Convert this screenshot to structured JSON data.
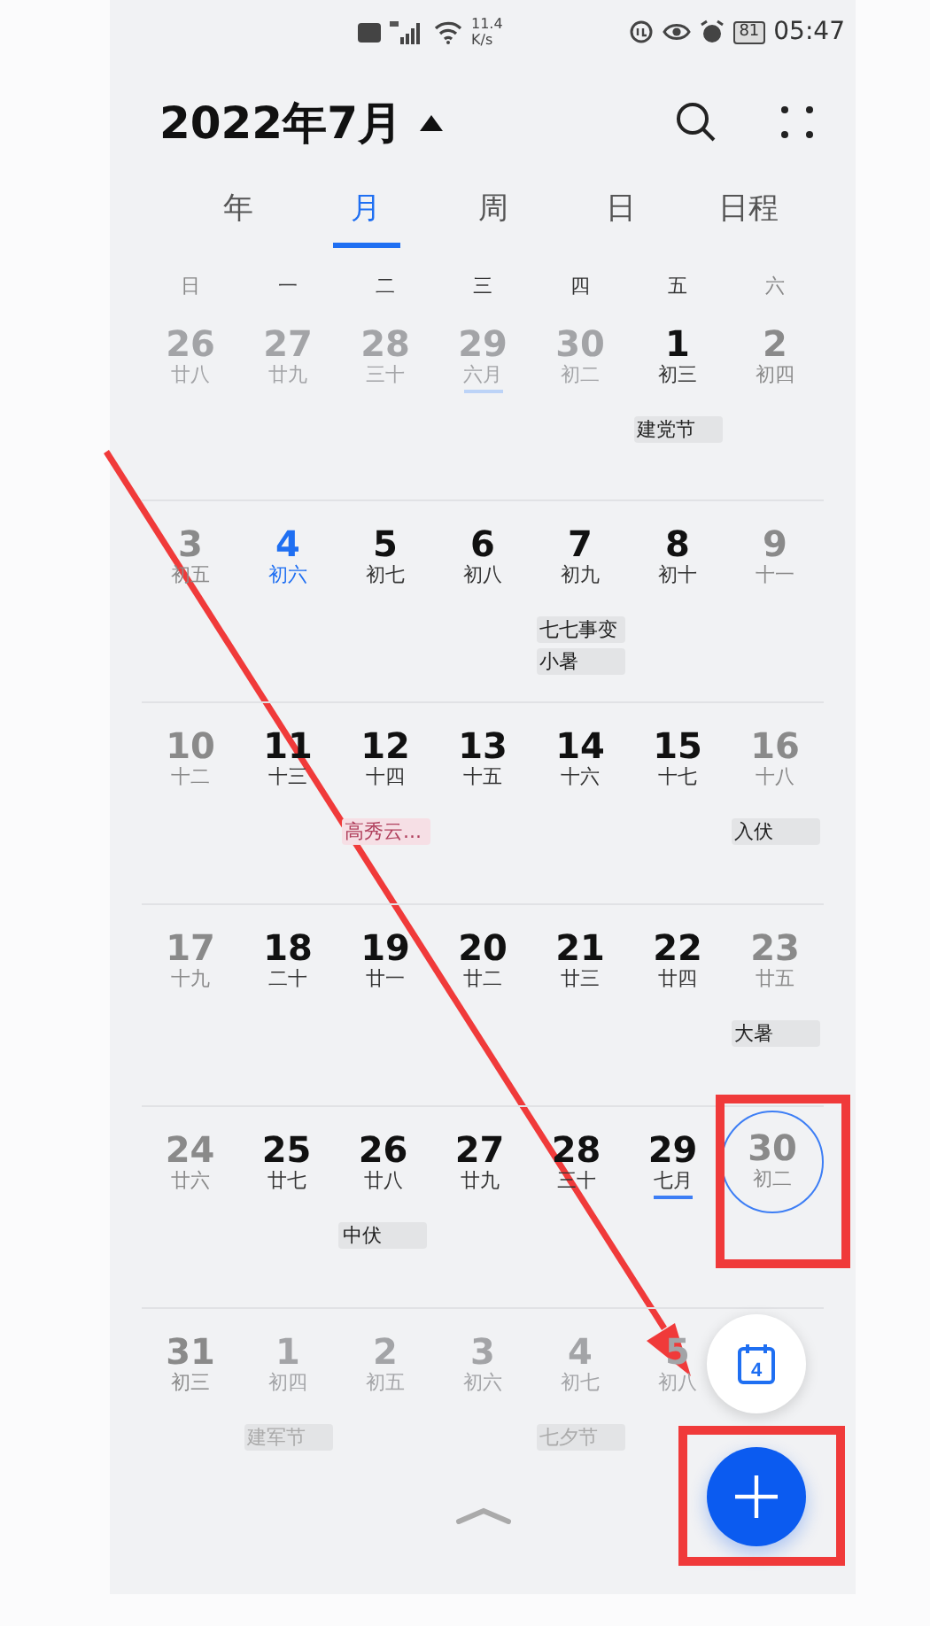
{
  "status_bar": {
    "speed_value": "11.4",
    "speed_unit": "K/s",
    "battery": "81",
    "time": "05:47"
  },
  "header": {
    "title": "2022年7月"
  },
  "tabs": [
    {
      "label": "年",
      "selected": false
    },
    {
      "label": "月",
      "selected": true
    },
    {
      "label": "周",
      "selected": false
    },
    {
      "label": "日",
      "selected": false
    },
    {
      "label": "日程",
      "selected": false
    }
  ],
  "weekdays": [
    {
      "label": "日",
      "weekend": true
    },
    {
      "label": "一",
      "weekend": false
    },
    {
      "label": "二",
      "weekend": false
    },
    {
      "label": "三",
      "weekend": false
    },
    {
      "label": "四",
      "weekend": false
    },
    {
      "label": "五",
      "weekend": false
    },
    {
      "label": "六",
      "weekend": true
    }
  ],
  "weeks": [
    [
      {
        "day": "26",
        "lunar": "廿八",
        "in_month": false,
        "today": false,
        "selected": false,
        "month_start": false
      },
      {
        "day": "27",
        "lunar": "廿九",
        "in_month": false,
        "today": false,
        "selected": false,
        "month_start": false
      },
      {
        "day": "28",
        "lunar": "三十",
        "in_month": false,
        "today": false,
        "selected": false,
        "month_start": false
      },
      {
        "day": "29",
        "lunar": "六月",
        "in_month": false,
        "today": false,
        "selected": false,
        "month_start": true
      },
      {
        "day": "30",
        "lunar": "初二",
        "in_month": false,
        "today": false,
        "selected": false,
        "month_start": false
      },
      {
        "day": "1",
        "lunar": "初三",
        "in_month": true,
        "weekend": false,
        "today": false,
        "selected": false,
        "month_start": false,
        "events": [
          {
            "label": "建党节",
            "color": "#e3e4e6"
          }
        ]
      },
      {
        "day": "2",
        "lunar": "初四",
        "in_month": true,
        "weekend": true,
        "today": false,
        "selected": false,
        "month_start": false
      }
    ],
    [
      {
        "day": "3",
        "lunar": "初五",
        "in_month": true,
        "weekend": true,
        "today": false,
        "selected": false,
        "month_start": false
      },
      {
        "day": "4",
        "lunar": "初六",
        "in_month": true,
        "weekend": false,
        "today": true,
        "selected": false,
        "month_start": false
      },
      {
        "day": "5",
        "lunar": "初七",
        "in_month": true,
        "weekend": false,
        "today": false,
        "selected": false,
        "month_start": false
      },
      {
        "day": "6",
        "lunar": "初八",
        "in_month": true,
        "weekend": false,
        "today": false,
        "selected": false,
        "month_start": false
      },
      {
        "day": "7",
        "lunar": "初九",
        "in_month": true,
        "weekend": false,
        "today": false,
        "selected": false,
        "month_start": false,
        "events": [
          {
            "label": "七七事变",
            "color": "#e3e4e6"
          },
          {
            "label": "小暑",
            "color": "#e3e4e6"
          }
        ]
      },
      {
        "day": "8",
        "lunar": "初十",
        "in_month": true,
        "weekend": false,
        "today": false,
        "selected": false,
        "month_start": false
      },
      {
        "day": "9",
        "lunar": "十一",
        "in_month": true,
        "weekend": true,
        "today": false,
        "selected": false,
        "month_start": false
      }
    ],
    [
      {
        "day": "10",
        "lunar": "十二",
        "in_month": true,
        "weekend": true,
        "today": false,
        "selected": false,
        "month_start": false
      },
      {
        "day": "11",
        "lunar": "十三",
        "in_month": true,
        "weekend": false,
        "today": false,
        "selected": false,
        "month_start": false
      },
      {
        "day": "12",
        "lunar": "十四",
        "in_month": true,
        "weekend": false,
        "today": false,
        "selected": false,
        "month_start": false,
        "events": [
          {
            "label": "高秀云...",
            "color": "#f6dfe5"
          }
        ]
      },
      {
        "day": "13",
        "lunar": "十五",
        "in_month": true,
        "weekend": false,
        "today": false,
        "selected": false,
        "month_start": false
      },
      {
        "day": "14",
        "lunar": "十六",
        "in_month": true,
        "weekend": false,
        "today": false,
        "selected": false,
        "month_start": false
      },
      {
        "day": "15",
        "lunar": "十七",
        "in_month": true,
        "weekend": false,
        "today": false,
        "selected": false,
        "month_start": false
      },
      {
        "day": "16",
        "lunar": "十八",
        "in_month": true,
        "weekend": true,
        "today": false,
        "selected": false,
        "month_start": false,
        "events": [
          {
            "label": "入伏",
            "color": "#e3e4e6"
          }
        ]
      }
    ],
    [
      {
        "day": "17",
        "lunar": "十九",
        "in_month": true,
        "weekend": true,
        "today": false,
        "selected": false,
        "month_start": false
      },
      {
        "day": "18",
        "lunar": "二十",
        "in_month": true,
        "weekend": false,
        "today": false,
        "selected": false,
        "month_start": false
      },
      {
        "day": "19",
        "lunar": "廿一",
        "in_month": true,
        "weekend": false,
        "today": false,
        "selected": false,
        "month_start": false
      },
      {
        "day": "20",
        "lunar": "廿二",
        "in_month": true,
        "weekend": false,
        "today": false,
        "selected": false,
        "month_start": false
      },
      {
        "day": "21",
        "lunar": "廿三",
        "in_month": true,
        "weekend": false,
        "today": false,
        "selected": false,
        "month_start": false
      },
      {
        "day": "22",
        "lunar": "廿四",
        "in_month": true,
        "weekend": false,
        "today": false,
        "selected": false,
        "month_start": false
      },
      {
        "day": "23",
        "lunar": "廿五",
        "in_month": true,
        "weekend": true,
        "today": false,
        "selected": false,
        "month_start": false,
        "events": [
          {
            "label": "大暑",
            "color": "#e3e4e6"
          }
        ]
      }
    ],
    [
      {
        "day": "24",
        "lunar": "廿六",
        "in_month": true,
        "weekend": true,
        "today": false,
        "selected": false,
        "month_start": false
      },
      {
        "day": "25",
        "lunar": "廿七",
        "in_month": true,
        "weekend": false,
        "today": false,
        "selected": false,
        "month_start": false
      },
      {
        "day": "26",
        "lunar": "廿八",
        "in_month": true,
        "weekend": false,
        "today": false,
        "selected": false,
        "month_start": false,
        "events": [
          {
            "label": "中伏",
            "color": "#e3e4e6"
          }
        ]
      },
      {
        "day": "27",
        "lunar": "廿九",
        "in_month": true,
        "weekend": false,
        "today": false,
        "selected": false,
        "month_start": false
      },
      {
        "day": "28",
        "lunar": "三十",
        "in_month": true,
        "weekend": false,
        "today": false,
        "selected": false,
        "month_start": false
      },
      {
        "day": "29",
        "lunar": "七月",
        "in_month": true,
        "weekend": false,
        "today": false,
        "selected": false,
        "month_start": true
      },
      {
        "day": "30",
        "lunar": "初二",
        "in_month": true,
        "weekend": true,
        "today": false,
        "selected": true,
        "month_start": false
      }
    ],
    [
      {
        "day": "31",
        "lunar": "初三",
        "in_month": true,
        "weekend": true,
        "today": false,
        "selected": false,
        "month_start": false
      },
      {
        "day": "1",
        "lunar": "初四",
        "in_month": false,
        "today": false,
        "selected": false,
        "month_start": false,
        "events": [
          {
            "label": "建军节",
            "color": "#e3e4e6"
          }
        ]
      },
      {
        "day": "2",
        "lunar": "初五",
        "in_month": false,
        "today": false,
        "selected": false,
        "month_start": false
      },
      {
        "day": "3",
        "lunar": "初六",
        "in_month": false,
        "today": false,
        "selected": false,
        "month_start": false
      },
      {
        "day": "4",
        "lunar": "初七",
        "in_month": false,
        "today": false,
        "selected": false,
        "month_start": false,
        "events": [
          {
            "label": "七夕节",
            "color": "#e3e4e6"
          }
        ]
      },
      {
        "day": "5",
        "lunar": "初八",
        "in_month": false,
        "today": false,
        "selected": false,
        "month_start": false
      }
    ]
  ],
  "today_button": {
    "label": "4"
  },
  "annotations": [
    {
      "kind": "arrow"
    },
    {
      "kind": "box"
    },
    {
      "kind": "box"
    }
  ]
}
